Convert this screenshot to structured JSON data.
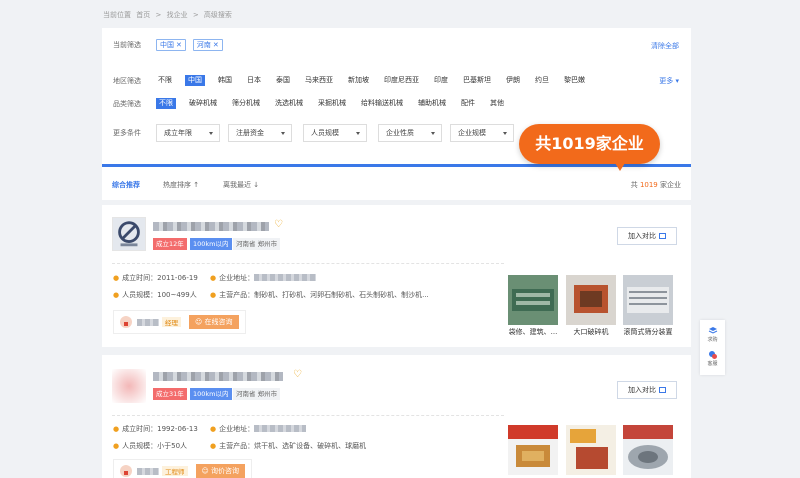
{
  "breadcrumb": [
    "当前位置",
    "首页",
    ">",
    "找企业",
    ">",
    "高级搜索"
  ],
  "filters": {
    "current_label": "当前筛选",
    "current_tags": [
      {
        "label": "中国"
      },
      {
        "label": "河南"
      }
    ],
    "clear_label": "清除全部",
    "region_label": "地区筛选",
    "region_options": [
      {
        "label": "不限",
        "selected": false
      },
      {
        "label": "中国",
        "selected": true
      },
      {
        "label": "韩国",
        "selected": false
      },
      {
        "label": "日本",
        "selected": false
      },
      {
        "label": "泰国",
        "selected": false
      },
      {
        "label": "马来西亚",
        "selected": false
      },
      {
        "label": "新加坡",
        "selected": false
      },
      {
        "label": "印度尼西亚",
        "selected": false
      },
      {
        "label": "印度",
        "selected": false
      },
      {
        "label": "巴基斯坦",
        "selected": false
      },
      {
        "label": "伊朗",
        "selected": false
      },
      {
        "label": "约旦",
        "selected": false
      },
      {
        "label": "黎巴嫩",
        "selected": false
      }
    ],
    "more_label": "更多",
    "product_label": "品类筛选",
    "product_options": [
      {
        "label": "不限",
        "selected": true
      },
      {
        "label": "破碎机械",
        "selected": false
      },
      {
        "label": "筛分机械",
        "selected": false
      },
      {
        "label": "洗选机械",
        "selected": false
      },
      {
        "label": "采掘机械",
        "selected": false
      },
      {
        "label": "给料输送机械",
        "selected": false
      },
      {
        "label": "辅助机械",
        "selected": false
      },
      {
        "label": "配件",
        "selected": false
      },
      {
        "label": "其他",
        "selected": false
      }
    ],
    "extra_label": "更多条件",
    "dropdowns": [
      {
        "label": "成立年限"
      },
      {
        "label": "注册资金"
      },
      {
        "label": "人员规模"
      },
      {
        "label": "企业性质"
      },
      {
        "label": "企业规模"
      }
    ],
    "callout": "共1019家企业"
  },
  "sort": {
    "options": [
      {
        "label": "综合推荐",
        "active": true
      },
      {
        "label": "热度排序 ↑",
        "active": false
      },
      {
        "label": "离我最近 ↓",
        "active": false
      }
    ],
    "total_prefix": "共",
    "total_count": "1019",
    "total_suffix": "家企业"
  },
  "companies": [
    {
      "badges": [
        "成立12年",
        "100km以内",
        "河南省 郑州市"
      ],
      "compare_label": "加入对比",
      "founded_label": "成立时间：",
      "founded": "2011-06-19",
      "address_label": "企业地址：",
      "staff_label": "人员规模：",
      "staff": "100~499人",
      "products_label": "主营产品：",
      "products": "制砂机、打砂机、河卵石制砂机、石头制砂机、制沙机...",
      "role": "经理",
      "consult_label": "在线咨询",
      "products_imgs": [
        {
          "caption": "袋修、建筑、...",
          "color": "#5c8a6a"
        },
        {
          "caption": "大口破碎机",
          "color": "#b85a3a"
        },
        {
          "caption": "滚筒式筛分装置",
          "color": "#9aa3ad"
        }
      ]
    },
    {
      "badges": [
        "成立31年",
        "100km以内",
        "河南省 郑州市"
      ],
      "compare_label": "加入对比",
      "founded_label": "成立时间：",
      "founded": "1992-06-13",
      "address_label": "企业地址：",
      "staff_label": "人员规模：",
      "staff": "小于50人",
      "products_label": "主营产品：",
      "products": "烘干机、选矿设备、破碎机、球磨机",
      "role": "工程师",
      "consult_label": "询价咨询",
      "products_imgs": [
        {
          "caption": "",
          "color": "#d03a2a"
        },
        {
          "caption": "",
          "color": "#e6a43a"
        },
        {
          "caption": "",
          "color": "#c4453a"
        }
      ]
    }
  ],
  "side": {
    "top_label": "求购",
    "bottom_label": "客服"
  }
}
